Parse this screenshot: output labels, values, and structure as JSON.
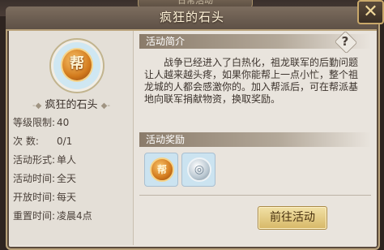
{
  "window": {
    "top_tab_label": "日常活动",
    "title": "疯狂的石头",
    "close_icon": "close-x-icon"
  },
  "left": {
    "item_name": "疯狂的石头",
    "emblem_char": "帮",
    "stats": [
      {
        "key": "等级限制:",
        "value": "40"
      },
      {
        "key": "次      数:",
        "value": "0/1"
      },
      {
        "key": "活动形式:",
        "value": "单人"
      },
      {
        "key": "活动时间:",
        "value": "全天"
      },
      {
        "key": "开放时间:",
        "value": "每天"
      },
      {
        "key": "重置时间:",
        "value": "凌晨4点"
      }
    ]
  },
  "intro": {
    "header": "活动简介",
    "help_label": "?",
    "text": "战争已经进入了白热化，祖龙联军的后勤问题让人越来越头疼，如果你能帮上一点小忙，整个祖龙城的人都会感激你的。加入帮派后，可在帮派基地向联军捐献物资，换取奖励。"
  },
  "rewards": {
    "header": "活动奖励",
    "items": [
      {
        "icon": "guild-coin-icon",
        "char": "帮"
      },
      {
        "icon": "silver-coin-icon",
        "char": "◎"
      }
    ]
  },
  "actions": {
    "go_label": "前往活动"
  }
}
